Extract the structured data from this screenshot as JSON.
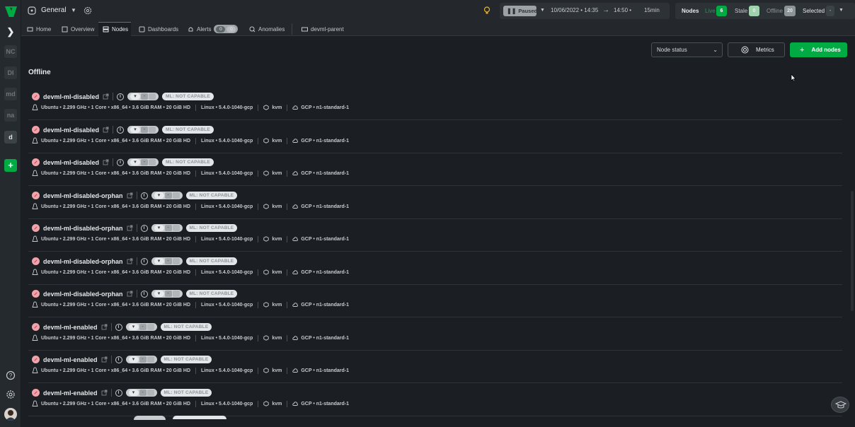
{
  "rail": {
    "spaces": [
      "NC",
      "DI",
      "md",
      "na",
      "d"
    ],
    "add_label": "+"
  },
  "topbar": {
    "room": "General",
    "playback": "Paused",
    "date_from": "10/06/2022 • 14:35",
    "date_to": "14:50 •",
    "duration": "15min",
    "nodes_label": "Nodes",
    "live_label": "Live",
    "live_count": "6",
    "stale_label": "Stale",
    "stale_count": "0",
    "offline_label": "Offline",
    "offline_count": "20",
    "selected_label": "Selected",
    "selected_count": "-"
  },
  "tabs": {
    "home": "Home",
    "overview": "Overview",
    "nodes": "Nodes",
    "dashboards": "Dashboards",
    "alerts": "Alerts",
    "alerts_count_a": "0",
    "alerts_count_b": "0",
    "anomalies": "Anomalies",
    "parent": "devml-parent"
  },
  "toolbar": {
    "node_status": "Node status",
    "metrics": "Metrics",
    "add_nodes": "Add nodes"
  },
  "section": "Offline",
  "nodes": [
    {
      "name": "devml-ml-disabled",
      "ml": "ML: NOT CAPABLE"
    },
    {
      "name": "devml-ml-disabled",
      "ml": "ML: NOT CAPABLE"
    },
    {
      "name": "devml-ml-disabled",
      "ml": "ML: NOT CAPABLE"
    },
    {
      "name": "devml-ml-disabled-orphan",
      "ml": "ML: NOT CAPABLE"
    },
    {
      "name": "devml-ml-disabled-orphan",
      "ml": "ML: NOT CAPABLE"
    },
    {
      "name": "devml-ml-disabled-orphan",
      "ml": "ML: NOT CAPABLE"
    },
    {
      "name": "devml-ml-disabled-orphan",
      "ml": "ML: NOT CAPABLE"
    },
    {
      "name": "devml-ml-enabled",
      "ml": "ML: NOT CAPABLE"
    },
    {
      "name": "devml-ml-enabled",
      "ml": "ML: NOT CAPABLE"
    },
    {
      "name": "devml-ml-enabled",
      "ml": "ML: NOT CAPABLE"
    }
  ],
  "node_info": {
    "os": "Ubuntu • 2.299 GHz • 1 Core • x86_64 • 3.6 GiB RAM • 20 GiB HD",
    "kernel": "Linux • 5.4.0-1040-gcp",
    "virt": "kvm",
    "cloud": "GCP • n1-standard-1",
    "alert_count": "-"
  },
  "colors": {
    "accent": "#00ab44",
    "offline": "#f0a3ab"
  }
}
